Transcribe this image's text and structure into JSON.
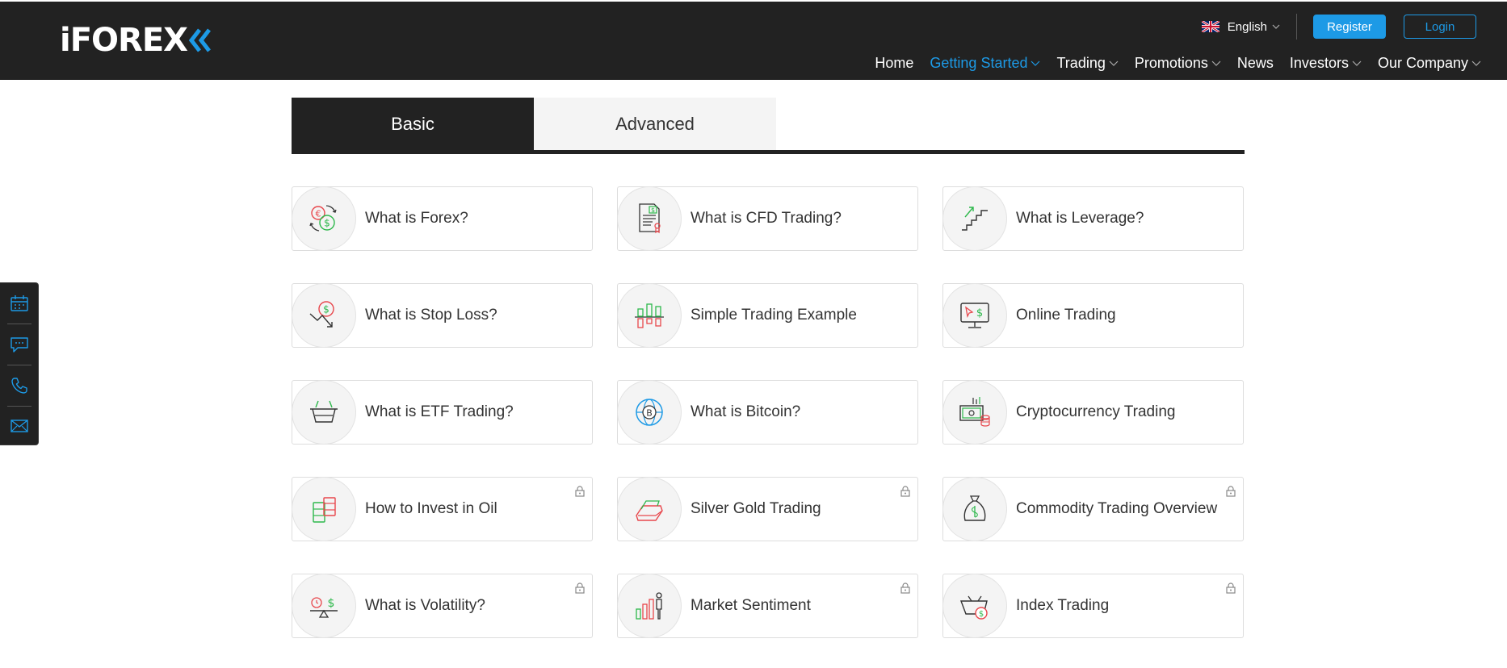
{
  "header": {
    "logo_text": "iFOREX",
    "language": "English",
    "register_label": "Register",
    "login_label": "Login",
    "accent_color": "#1d9ae6",
    "background_color": "#222222"
  },
  "nav": {
    "items": [
      {
        "label": "Home",
        "dropdown": false,
        "active": false
      },
      {
        "label": "Getting Started",
        "dropdown": true,
        "active": true
      },
      {
        "label": "Trading",
        "dropdown": true,
        "active": false
      },
      {
        "label": "Promotions",
        "dropdown": true,
        "active": false
      },
      {
        "label": "News",
        "dropdown": false,
        "active": false
      },
      {
        "label": "Investors",
        "dropdown": true,
        "active": false
      },
      {
        "label": "Our Company",
        "dropdown": true,
        "active": false
      }
    ]
  },
  "tabs": {
    "basic": "Basic",
    "advanced": "Advanced",
    "selected": "Basic"
  },
  "cards": [
    {
      "label": "What is Forex?",
      "icon": "currency-exchange-icon",
      "locked": false
    },
    {
      "label": "What is CFD Trading?",
      "icon": "contract-document-icon",
      "locked": false
    },
    {
      "label": "What is Leverage?",
      "icon": "stairs-arrow-icon",
      "locked": false
    },
    {
      "label": "What is Stop Loss?",
      "icon": "stop-loss-arrow-icon",
      "locked": false
    },
    {
      "label": "Simple Trading Example",
      "icon": "candlestick-icon",
      "locked": false
    },
    {
      "label": "Online Trading",
      "icon": "monitor-trading-icon",
      "locked": false
    },
    {
      "label": "What is ETF Trading?",
      "icon": "basket-icon",
      "locked": false
    },
    {
      "label": "What is Bitcoin?",
      "icon": "bitcoin-globe-icon",
      "locked": false
    },
    {
      "label": "Cryptocurrency Trading",
      "icon": "crypto-banknote-icon",
      "locked": false
    },
    {
      "label": "How to Invest in Oil",
      "icon": "oil-barrels-icon",
      "locked": true
    },
    {
      "label": "Silver Gold Trading",
      "icon": "gold-bars-icon",
      "locked": true
    },
    {
      "label": "Commodity Trading Overview",
      "icon": "commodity-sack-icon",
      "locked": true
    },
    {
      "label": "What is Volatility?",
      "icon": "balance-scale-icon",
      "locked": true
    },
    {
      "label": "Market Sentiment",
      "icon": "market-sentiment-icon",
      "locked": true
    },
    {
      "label": "Index Trading",
      "icon": "index-basket-icon",
      "locked": true
    }
  ],
  "side_widget": {
    "icons": [
      "calendar-icon",
      "chat-icon",
      "phone-icon",
      "mail-icon"
    ]
  }
}
